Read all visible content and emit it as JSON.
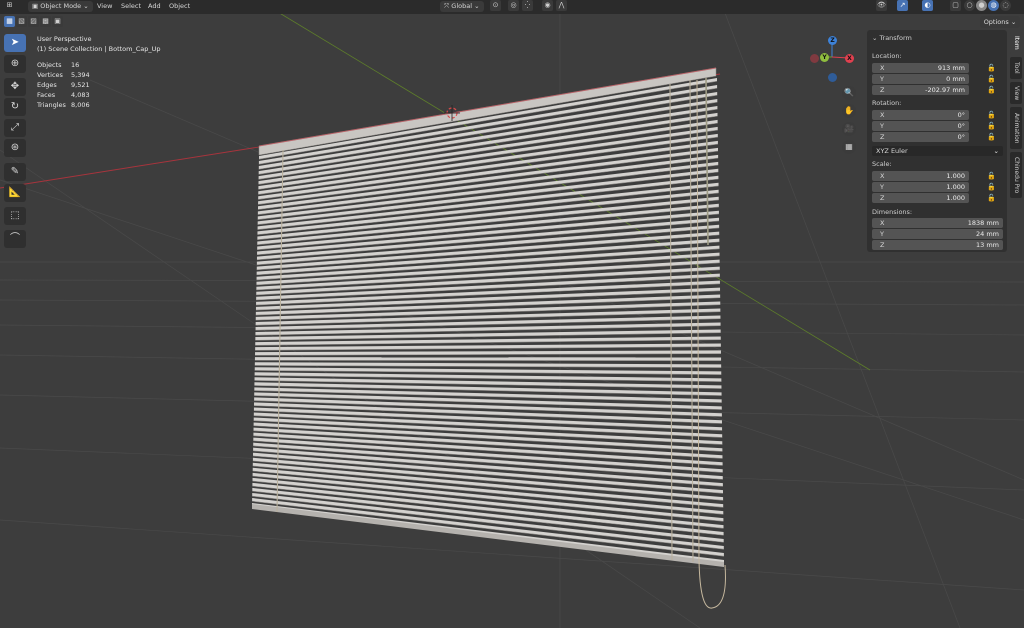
{
  "header": {
    "mode": "Object Mode",
    "menus": [
      "View",
      "Select",
      "Add",
      "Object"
    ],
    "orientation": "Global",
    "options_label": "Options"
  },
  "overlay": {
    "view_name": "User Perspective",
    "collection": "(1) Scene Collection | Bottom_Cap_Up",
    "stats": [
      {
        "label": "Objects",
        "value": "16"
      },
      {
        "label": "Vertices",
        "value": "5,394"
      },
      {
        "label": "Edges",
        "value": "9,521"
      },
      {
        "label": "Faces",
        "value": "4,083"
      },
      {
        "label": "Triangles",
        "value": "8,006"
      }
    ]
  },
  "gizmo": {
    "x": "X",
    "y": "Y",
    "z": "Z"
  },
  "transform": {
    "title": "Transform",
    "location_label": "Location:",
    "location": [
      {
        "axis": "X",
        "value": "913 mm"
      },
      {
        "axis": "Y",
        "value": "0 mm"
      },
      {
        "axis": "Z",
        "value": "-202.97 mm"
      }
    ],
    "rotation_label": "Rotation:",
    "rotation": [
      {
        "axis": "X",
        "value": "0°"
      },
      {
        "axis": "Y",
        "value": "0°"
      },
      {
        "axis": "Z",
        "value": "0°"
      }
    ],
    "rotation_mode": "XYZ Euler",
    "scale_label": "Scale:",
    "scale": [
      {
        "axis": "X",
        "value": "1.000"
      },
      {
        "axis": "Y",
        "value": "1.000"
      },
      {
        "axis": "Z",
        "value": "1.000"
      }
    ],
    "dimensions_label": "Dimensions:",
    "dimensions": [
      {
        "axis": "X",
        "value": "1838 mm"
      },
      {
        "axis": "Y",
        "value": "24 mm"
      },
      {
        "axis": "Z",
        "value": "13 mm"
      }
    ]
  },
  "sidebar_tabs": [
    "Item",
    "Tool",
    "View",
    "Animation",
    "Chinedu Pro"
  ],
  "colors": {
    "accent": "#4772b3",
    "x_axis": "#e0404f",
    "y_axis": "#6f9c2b",
    "z_axis": "#3d82d9"
  }
}
